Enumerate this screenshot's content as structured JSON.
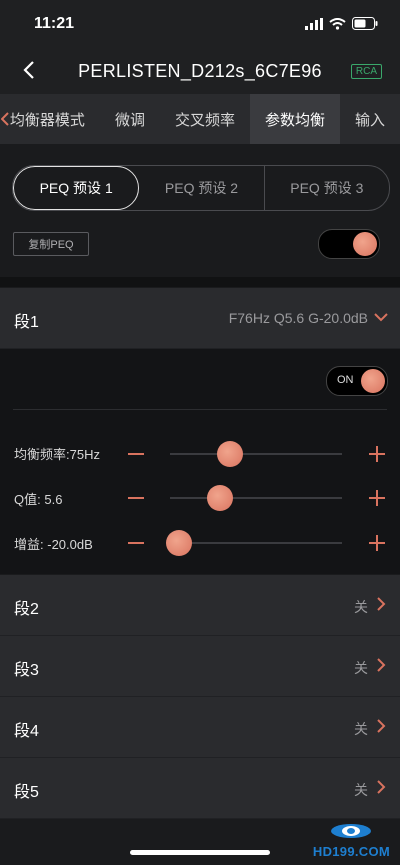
{
  "status": {
    "time": "11:21"
  },
  "nav": {
    "title": "PERLISTEN_D212s_6C7E96",
    "badge": "RCA"
  },
  "tabs": [
    {
      "label": "均衡器模式"
    },
    {
      "label": "微调"
    },
    {
      "label": "交叉频率"
    },
    {
      "label": "参数均衡"
    },
    {
      "label": "输入"
    }
  ],
  "presets": [
    {
      "label": "PEQ 预设 1"
    },
    {
      "label": "PEQ 预设 2"
    },
    {
      "label": "PEQ 预设 3"
    }
  ],
  "copy_button": "复制PEQ",
  "segment1": {
    "name": "段1",
    "summary": "F76Hz Q5.6 G-20.0dB",
    "switch_label": "ON",
    "params": [
      {
        "label": "均衡频率:",
        "value": "75Hz",
        "level": 0.35
      },
      {
        "label": "Q值:",
        "value": "5.6",
        "level": 0.29
      },
      {
        "label": "增益:",
        "value": "-20.0dB",
        "level": 0.05
      }
    ]
  },
  "segments": [
    {
      "name": "段2",
      "state": "关"
    },
    {
      "name": "段3",
      "state": "关"
    },
    {
      "name": "段4",
      "state": "关"
    },
    {
      "name": "段5",
      "state": "关"
    }
  ],
  "watermark": "HD199.COM",
  "colors": {
    "accent": "#d9735f",
    "badge": "#3aa86b",
    "background": "#1a1b1d"
  }
}
